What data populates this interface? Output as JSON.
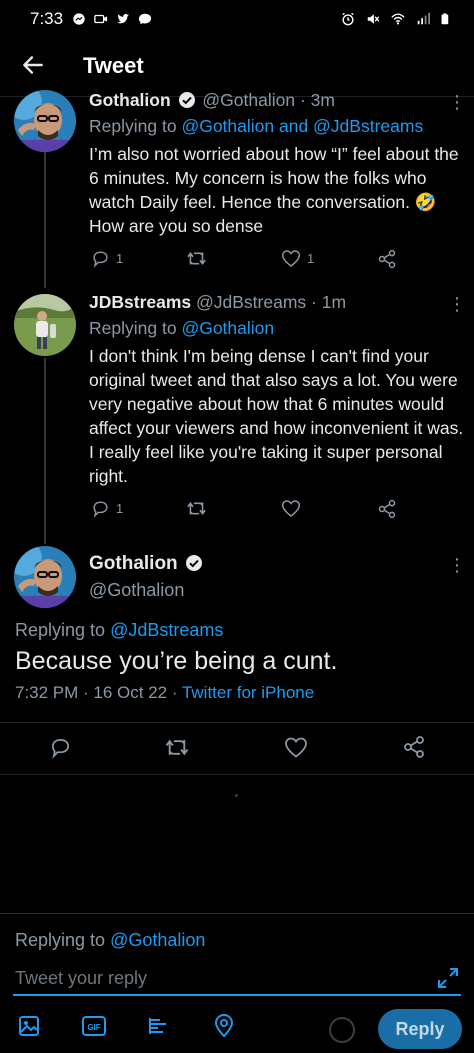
{
  "status_bar": {
    "time": "7:33"
  },
  "header": {
    "title": "Tweet"
  },
  "tweet1": {
    "name": "Gothalion",
    "handle": "@Gothalion",
    "age": "· 3m",
    "replying_prefix": "Replying to",
    "replying_to": "@Gothalion and @JdBstreams",
    "text": "I’m also not worried about how “I” feel about the 6 minutes. My concern is how the folks who watch Daily feel. Hence the conversation. 🤣 How are you so dense",
    "reply_count": "1",
    "like_count": "1"
  },
  "tweet2": {
    "name": "JDBstreams",
    "handle": "@JdBstreams",
    "age": "· 1m",
    "replying_prefix": "Replying to",
    "replying_to": "@Gothalion",
    "text": "I don't think I'm being dense I can't find your original tweet and that also says a lot. You were very negative about how that 6 minutes would affect your viewers and how inconvenient it was. I really feel like you're taking it super personal right.",
    "reply_count": "1"
  },
  "main_tweet": {
    "name": "Gothalion",
    "handle": "@Gothalion",
    "replying_prefix": "Replying to",
    "replying_to": "@JdBstreams",
    "text": "Because you’re being a cunt.",
    "timestamp": "7:32 PM · 16 Oct 22 · ",
    "source": "Twitter for iPhone"
  },
  "composer": {
    "replying_prefix": "Replying to",
    "replying_to": "@Gothalion",
    "placeholder": "Tweet your reply",
    "reply_button": "Reply"
  },
  "colors": {
    "accent": "#1d9bf0",
    "muted": "#8b98a5",
    "background": "#000000"
  }
}
